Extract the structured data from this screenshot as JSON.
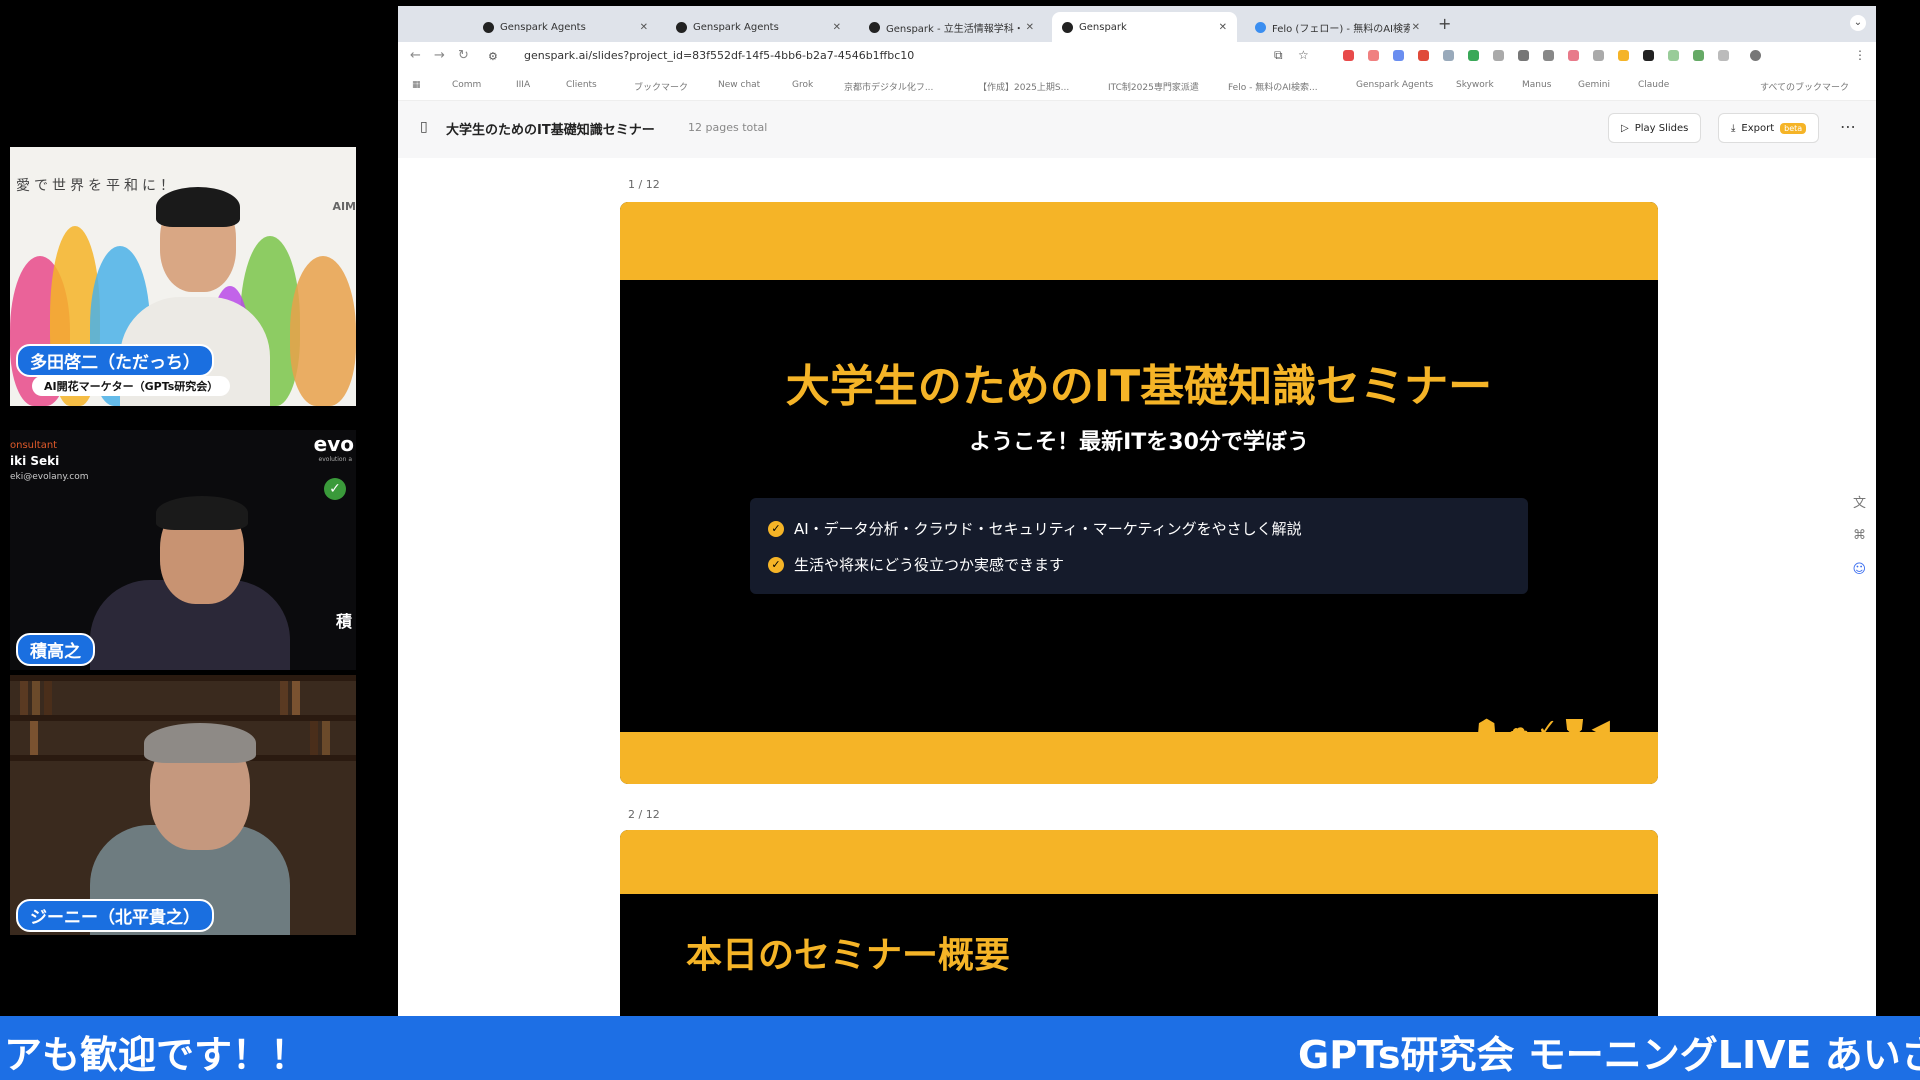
{
  "participants": [
    {
      "name": "多田啓二（ただっち）",
      "subtitle": "AI開花マーケター（GPTs研究会）",
      "background_text": "愛で世界を平和に！",
      "logo_text": "AIM"
    },
    {
      "name": "積高之",
      "consultant_label": "onsultant",
      "card_name": "iki Seki",
      "card_email": "eki@evolany.com",
      "brand": "evo",
      "brand_sub": "evolution a",
      "side_kanji": "積"
    },
    {
      "name": "ジーニー（北平貴之）"
    }
  ],
  "browser": {
    "tabs": [
      {
        "label": "Genspark Agents",
        "active": false
      },
      {
        "label": "Genspark Agents",
        "active": false
      },
      {
        "label": "Genspark - 立生活情報学科・初",
        "active": false
      },
      {
        "label": "Genspark",
        "active": true
      },
      {
        "label": "Felo (フェロー) - 無料のAI検索",
        "active": false
      }
    ],
    "url": "genspark.ai/slides?project_id=83f552df-14f5-4bb6-b2a7-4546b1ffbc10",
    "bookmarks": [
      "Comm",
      "IIIA",
      "Clients",
      "ブックマーク",
      "New chat",
      "Grok",
      "京都市デジタル化フ...",
      "【作成】2025上期S...",
      "ITC制2025専門家派遣",
      "Felo - 無料のAI検索...",
      "Genspark Agents",
      "Skywork",
      "Manus",
      "Gemini",
      "Claude",
      "すべてのブックマーク"
    ]
  },
  "app": {
    "project_title": "大学生のためのIT基礎知識セミナー",
    "page_count": "12 pages total",
    "play_label": "Play Slides",
    "export_label": "Export",
    "beta_label": "beta"
  },
  "slides": [
    {
      "page": "1 / 12",
      "title": "大学生のためのIT基礎知識セミナー",
      "subtitle": "ようこそ！最新ITを30分で学ぼう",
      "bullets": [
        "AI・データ分析・クラウド・セキュリティ・マーケティングをやさしく解説",
        "生活や将来にどう役立つか実感できます"
      ]
    },
    {
      "page": "2 / 12",
      "title": "本日のセミナー概要"
    }
  ],
  "ticker": {
    "left_text": "アも歓迎です！！",
    "right_text": "GPTs研究会 モーニングLIVE あいさ"
  },
  "colors": {
    "accent": "#f5b427",
    "ticker": "#1d6fe5",
    "name_tag": "#1a6fe0"
  }
}
